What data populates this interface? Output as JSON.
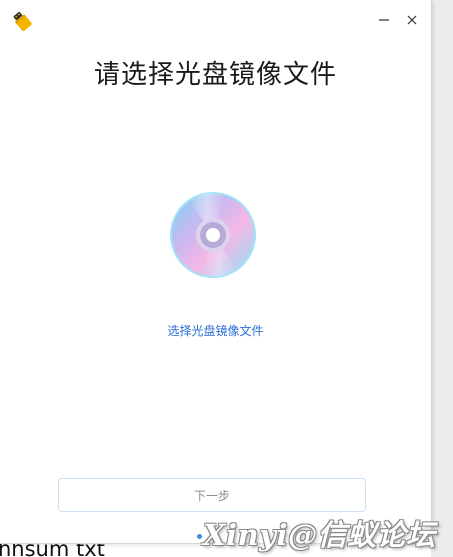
{
  "window": {
    "title": "请选择光盘镜像文件",
    "app_icon": "usb-drive-icon",
    "controls": {
      "minimize_icon": "minimize-icon",
      "close_icon": "close-icon"
    }
  },
  "main": {
    "disc_icon": "optical-disc-icon",
    "select_link": "选择光盘镜像文件",
    "next_button": "下一步"
  },
  "background": {
    "partial_text": "hhsum txt"
  },
  "watermark": {
    "text": "Xinyi@信蚁论坛"
  },
  "colors": {
    "link": "#2b6fd6",
    "button_border": "#cfe0f2",
    "button_text": "#8a8a8a",
    "indicator_dot": "#3d8ee8",
    "app_icon_yellow": "#f4b400"
  }
}
